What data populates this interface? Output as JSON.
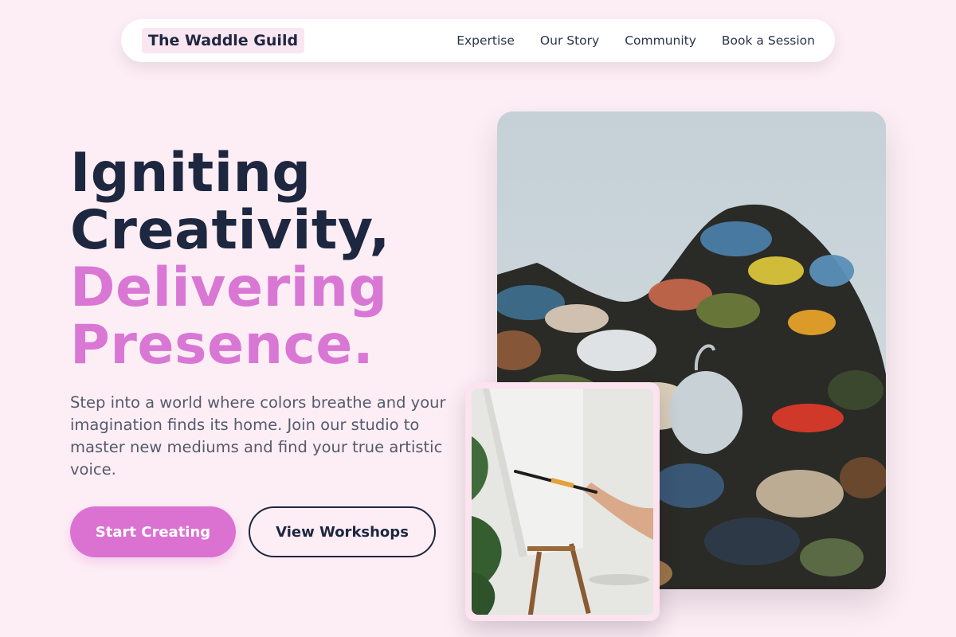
{
  "brand": {
    "name": "The Waddle Guild"
  },
  "nav": {
    "links": [
      "Expertise",
      "Our Story",
      "Community",
      "Book a Session"
    ]
  },
  "hero": {
    "headline_line1": "Igniting",
    "headline_line2": "Creativity,",
    "headline_line3": "Delivering",
    "headline_line4": "Presence.",
    "subtext": "Step into a world where colors breathe and your imagination finds its home. Join our studio to master new mediums and find your true artistic voice.",
    "primary_button": "Start Creating",
    "secondary_button": "View Workshops"
  },
  "images": {
    "main_alt": "Paint palette covered in colorful oil paint",
    "inset_alt": "Hand painting on a canvas at an easel"
  },
  "colors": {
    "background": "#fdeef5",
    "navy": "#1e2740",
    "accent_pink": "#db72d2",
    "headline_pink": "#d977d4"
  }
}
